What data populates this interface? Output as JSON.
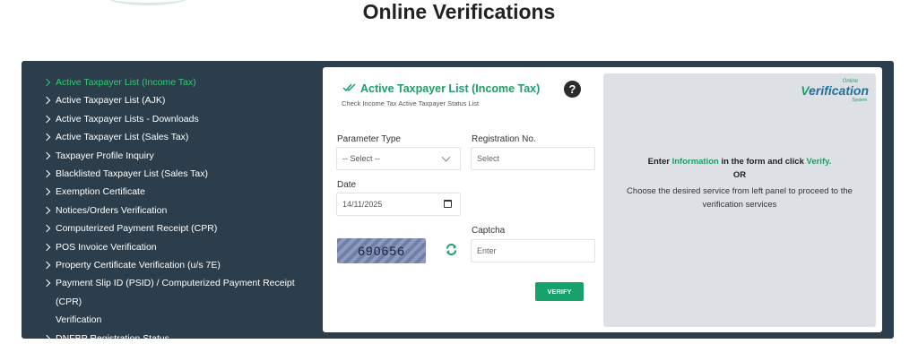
{
  "page": {
    "title": "Online Verifications"
  },
  "sidebar": {
    "items": [
      {
        "label": "Active Taxpayer List (Income Tax)",
        "active": true
      },
      {
        "label": "Active Taxpayer List (AJK)"
      },
      {
        "label": "Active Taxpayer Lists - Downloads"
      },
      {
        "label": "Active Taxpayer List (Sales Tax)"
      },
      {
        "label": "Taxpayer Profile Inquiry"
      },
      {
        "label": "Blacklisted Taxpayer List (Sales Tax)"
      },
      {
        "label": "Exemption Certificate"
      },
      {
        "label": "Notices/Orders Verification"
      },
      {
        "label": "Computerized Payment Receipt (CPR)"
      },
      {
        "label": "POS Invoice Verification"
      },
      {
        "label": "Property Certificate Verification (u/s 7E)"
      },
      {
        "label": "Payment Slip ID (PSID) / Computerized Payment Receipt (CPR)",
        "label2": "Verification"
      },
      {
        "label": "DNFBP Registration Status"
      }
    ]
  },
  "form": {
    "title": "Active Taxpayer List (Income Tax)",
    "subtitle": "Check Income Tax Active Taxpayer Status List",
    "help_icon": "?",
    "parameter_type": {
      "label": "Parameter Type",
      "value": "-- Select --"
    },
    "registration": {
      "label": "Registration No.",
      "placeholder": "Select"
    },
    "date": {
      "label": "Date",
      "value": "14/11/2025"
    },
    "captcha": {
      "label": "Captcha",
      "image_text": "690656",
      "placeholder": "Enter"
    },
    "verify_label": "VERIFY"
  },
  "info": {
    "brand_online": "Online",
    "brand_main_v": "V",
    "brand_main_rest": "erification",
    "brand_system": "System",
    "line1_pre": "Enter ",
    "line1_info": "Information",
    "line1_mid": " in the form and click ",
    "line1_verify": "Verify.",
    "or": "OR",
    "line3": "Choose the desired service from left panel to proceed to the verification services"
  },
  "colors": {
    "accent": "#1e9e6b",
    "panel": "#2c3e4c",
    "active_link": "#2ecc71"
  }
}
